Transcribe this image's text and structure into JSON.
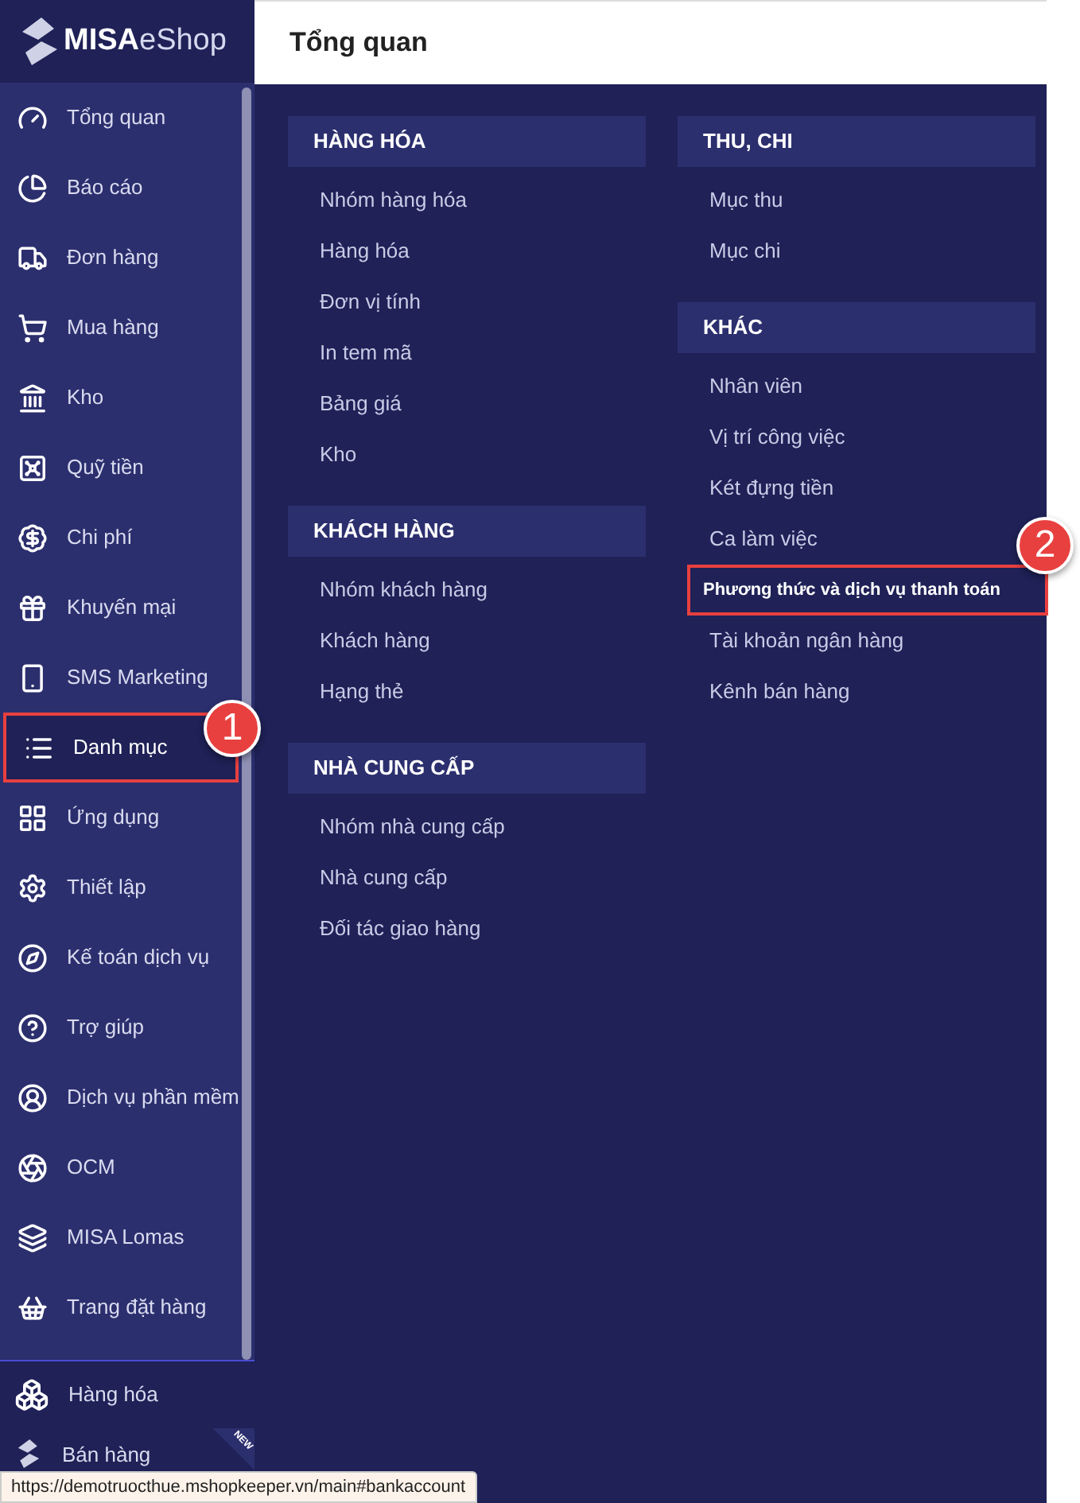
{
  "logo": {
    "brand_bold": "MISA",
    "brand_light": "eShop"
  },
  "header": {
    "title": "Tổng quan"
  },
  "sidebar": {
    "items": [
      {
        "label": "Tổng quan",
        "selected": false
      },
      {
        "label": "Báo cáo",
        "selected": false
      },
      {
        "label": "Đơn hàng",
        "selected": false
      },
      {
        "label": "Mua hàng",
        "selected": false
      },
      {
        "label": "Kho",
        "selected": false
      },
      {
        "label": "Quỹ tiền",
        "selected": false
      },
      {
        "label": "Chi phí",
        "selected": false
      },
      {
        "label": "Khuyến mại",
        "selected": false
      },
      {
        "label": "SMS Marketing",
        "selected": false
      },
      {
        "label": "Danh mục",
        "selected": true,
        "callout": "1"
      },
      {
        "label": "Ứng dụng",
        "selected": false
      },
      {
        "label": "Thiết lập",
        "selected": false
      },
      {
        "label": "Kế toán dịch vụ",
        "selected": false
      },
      {
        "label": "Trợ giúp",
        "selected": false
      },
      {
        "label": "Dịch vụ phần mềm",
        "selected": false
      },
      {
        "label": "OCM",
        "selected": false
      },
      {
        "label": "MISA Lomas",
        "selected": false
      },
      {
        "label": "Trang đặt hàng",
        "selected": false
      }
    ],
    "bottom_items": [
      {
        "label": "Hàng hóa"
      },
      {
        "label": "Bán hàng",
        "badge": "NEW"
      }
    ]
  },
  "columns": [
    {
      "groups": [
        {
          "title": "HÀNG HÓA",
          "items": [
            {
              "label": "Nhóm hàng hóa",
              "selected": false
            },
            {
              "label": "Hàng hóa",
              "selected": false
            },
            {
              "label": "Đơn vị tính",
              "selected": false
            },
            {
              "label": "In tem mã",
              "selected": false
            },
            {
              "label": "Bảng giá",
              "selected": false
            },
            {
              "label": "Kho",
              "selected": false
            }
          ]
        },
        {
          "title": "KHÁCH HÀNG",
          "items": [
            {
              "label": "Nhóm khách hàng",
              "selected": false
            },
            {
              "label": "Khách hàng",
              "selected": false
            },
            {
              "label": "Hạng thẻ",
              "selected": false
            }
          ]
        },
        {
          "title": "NHÀ CUNG CẤP",
          "items": [
            {
              "label": "Nhóm nhà cung cấp",
              "selected": false
            },
            {
              "label": "Nhà cung cấp",
              "selected": false
            },
            {
              "label": "Đối tác giao hàng",
              "selected": false
            }
          ]
        }
      ]
    },
    {
      "groups": [
        {
          "title": "THU, CHI",
          "items": [
            {
              "label": "Mục thu",
              "selected": false
            },
            {
              "label": "Mục chi",
              "selected": false
            }
          ]
        },
        {
          "title": "KHÁC",
          "items": [
            {
              "label": "Nhân viên",
              "selected": false
            },
            {
              "label": "Vị trí công việc",
              "selected": false
            },
            {
              "label": "Két đựng tiền",
              "selected": false
            },
            {
              "label": "Ca làm việc",
              "selected": false
            },
            {
              "label": "Phương thức và dịch vụ thanh toán",
              "selected": true,
              "callout": "2"
            },
            {
              "label": "Tài khoản ngân hàng",
              "selected": false
            },
            {
              "label": "Kênh bán hàng",
              "selected": false
            }
          ]
        }
      ]
    }
  ],
  "status_bar": {
    "url": "https://demotruocthue.mshopkeeper.vn/main#bankaccount"
  }
}
